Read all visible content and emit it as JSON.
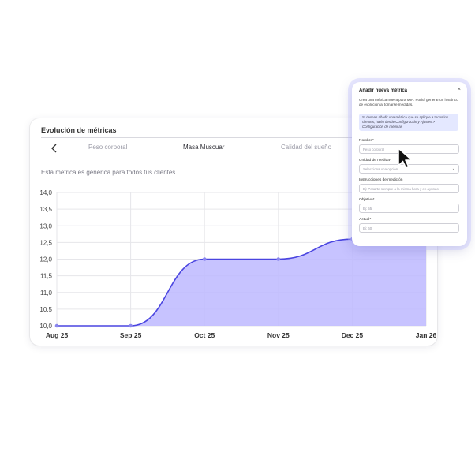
{
  "card": {
    "title": "Evolución de métricas",
    "tabs": [
      {
        "label": "Peso corporal",
        "active": false
      },
      {
        "label": "Masa Muscuar",
        "active": true
      },
      {
        "label": "Calidad del sueño",
        "active": false
      }
    ],
    "subtitle": "Esta métrica es genérica para todos tus clientes"
  },
  "chart_data": {
    "type": "area",
    "title": "",
    "xlabel": "",
    "ylabel": "",
    "x_categories": [
      "Aug 25",
      "Sep 25",
      "Oct 25",
      "Nov 25",
      "Dec 25",
      "Jan 26"
    ],
    "yticks": [
      "10,0",
      "10,5",
      "11,0",
      "11,5",
      "12,0",
      "12,5",
      "13,0",
      "13,5",
      "14,0"
    ],
    "ylim": [
      10.0,
      14.0
    ],
    "grid": true,
    "series": [
      {
        "values": [
          10.0,
          10.0,
          12.0,
          12.0,
          12.6,
          13.3
        ],
        "color": "#4a45e0",
        "fill": "#bdb8ff"
      }
    ]
  },
  "modal": {
    "title": "Añadir nueva métrica",
    "close": "×",
    "description": "Crea una métrica nueva para MIA. Podrá generar un histórico de evolución al tomarse medidas.",
    "info_text": "Si deseas añadir una métrica que se aplique a todos los clientes, hazlo desde",
    "info_link": "Configuración y Ajustes > Configuración de métricas",
    "fields": [
      {
        "label": "Nombre*",
        "placeholder": "Peso corporal"
      },
      {
        "label": "Unidad de medida*",
        "placeholder": "Selecciona una opción"
      },
      {
        "label": "Instrucciones de medición",
        "placeholder": "Ej: Pesarte siempre a la misma hora y en ayunas"
      },
      {
        "label": "Objetivo*",
        "placeholder": "Ej: 55"
      },
      {
        "label": "Actual*",
        "placeholder": "Ej: 60"
      }
    ],
    "chevron": "⌄"
  },
  "icons": {
    "back": "chevron-left-icon",
    "cursor": "mouse-pointer-icon"
  }
}
